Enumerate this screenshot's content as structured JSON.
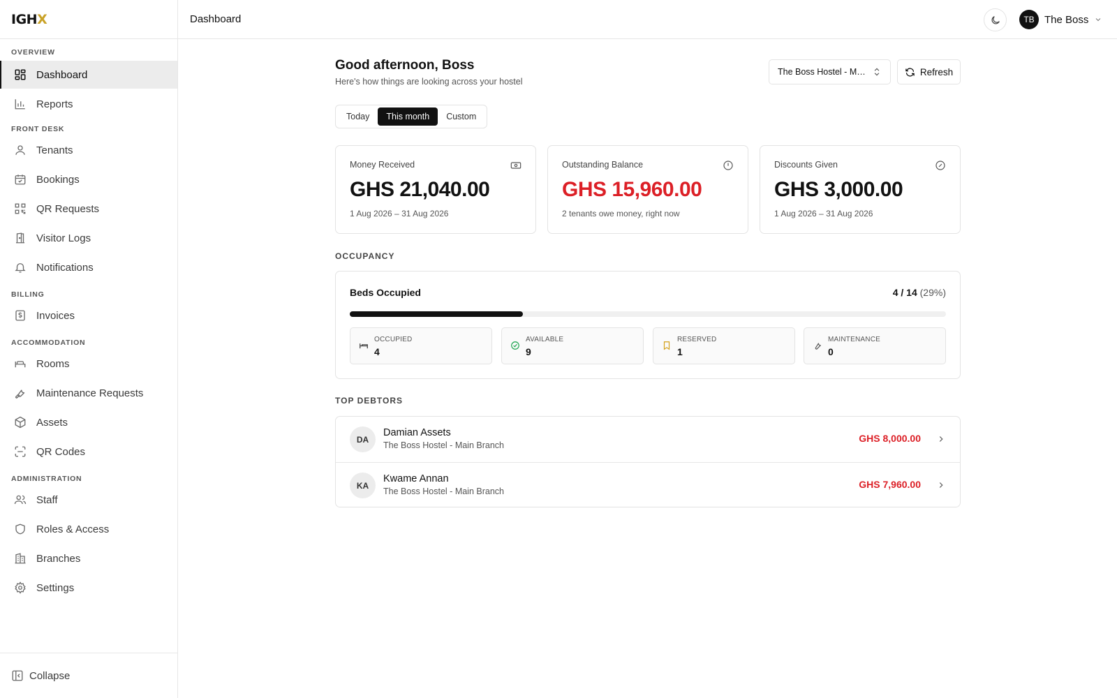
{
  "brand": {
    "logo_main": "IGH",
    "logo_accent": "X"
  },
  "sidebar": {
    "sections": [
      {
        "label": "OVERVIEW"
      },
      {
        "label": "FRONT DESK"
      },
      {
        "label": "BILLING"
      },
      {
        "label": "ACCOMMODATION"
      },
      {
        "label": "ADMINISTRATION"
      }
    ],
    "items": [
      {
        "label": "Dashboard",
        "icon": "dashboard-icon",
        "active": true
      },
      {
        "label": "Reports",
        "icon": "bar-chart-icon"
      },
      {
        "label": "Tenants",
        "icon": "user-icon"
      },
      {
        "label": "Bookings",
        "icon": "calendar-check-icon"
      },
      {
        "label": "QR Requests",
        "icon": "qr-code-icon"
      },
      {
        "label": "Visitor Logs",
        "icon": "door-icon"
      },
      {
        "label": "Notifications",
        "icon": "bell-icon"
      },
      {
        "label": "Invoices",
        "icon": "receipt-dollar-icon"
      },
      {
        "label": "Rooms",
        "icon": "bed-icon"
      },
      {
        "label": "Maintenance Requests",
        "icon": "wrench-icon"
      },
      {
        "label": "Assets",
        "icon": "box-icon"
      },
      {
        "label": "QR Codes",
        "icon": "scan-icon"
      },
      {
        "label": "Staff",
        "icon": "users-icon"
      },
      {
        "label": "Roles & Access",
        "icon": "shield-icon"
      },
      {
        "label": "Branches",
        "icon": "building-icon"
      },
      {
        "label": "Settings",
        "icon": "gear-icon"
      }
    ],
    "collapse_label": "Collapse"
  },
  "topbar": {
    "title": "Dashboard",
    "user": {
      "initials": "TB",
      "name": "The Boss"
    }
  },
  "main": {
    "greeting": "Good afternoon, Boss",
    "subtitle": "Here's how things are looking across your hostel",
    "branch_select": "The Boss Hostel - Main Branch",
    "refresh_label": "Refresh",
    "ranges": [
      "Today",
      "This month",
      "Custom"
    ],
    "selected_range": "This month",
    "cards": [
      {
        "label": "Money Received",
        "value": "GHS 21,040.00",
        "note": "1 Aug 2026 – 31 Aug 2026",
        "icon": "banknote-icon"
      },
      {
        "label": "Outstanding Balance",
        "value": "GHS 15,960.00",
        "note": "2 tenants owe money, right now",
        "icon": "alert-circle-icon",
        "value_color": "#dc1f26"
      },
      {
        "label": "Discounts Given",
        "value": "GHS 3,000.00",
        "note": "1 Aug 2026 – 31 Aug 2026",
        "icon": "badge-percent-icon"
      }
    ],
    "occupancy": {
      "heading": "OCCUPANCY",
      "title": "Beds Occupied",
      "ratio": "4 / 14",
      "percent_label": "(29%)",
      "fill_fraction": 0.29,
      "tiles": [
        {
          "label": "OCCUPIED",
          "value": "4",
          "icon": "bed-icon"
        },
        {
          "label": "AVAILABLE",
          "value": "9",
          "icon": "check-circle-icon",
          "color": "#16a34a"
        },
        {
          "label": "RESERVED",
          "value": "1",
          "icon": "bookmark-icon",
          "color": "#d4a017"
        },
        {
          "label": "MAINTENANCE",
          "value": "0",
          "icon": "wrench-icon"
        }
      ]
    },
    "debtors": {
      "heading": "TOP DEBTORS",
      "rows": [
        {
          "initials": "DA",
          "name": "Damian Assets",
          "branch": "The Boss Hostel - Main Branch",
          "amount": "GHS 8,000.00"
        },
        {
          "initials": "KA",
          "name": "Kwame Annan",
          "branch": "The Boss Hostel - Main Branch",
          "amount": "GHS 7,960.00"
        }
      ]
    }
  },
  "colors": {
    "accent": "#111111",
    "danger": "#dc1f26",
    "logo_accent": "#c9a227"
  }
}
